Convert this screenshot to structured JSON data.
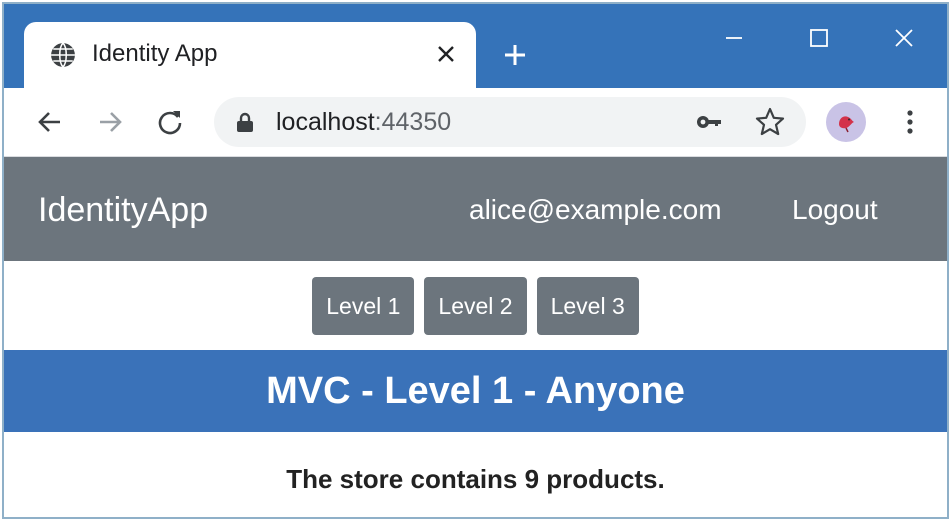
{
  "browser": {
    "tab": {
      "title": "Identity App",
      "favicon": "globe-icon",
      "close_icon": "close-icon"
    },
    "new_tab_icon": "plus-icon",
    "window_controls": [
      "minimize-icon",
      "maximize-icon",
      "close-icon"
    ],
    "toolbar": {
      "back_icon": "arrow-left-icon",
      "forward_icon": "arrow-right-icon",
      "reload_icon": "reload-icon",
      "url_host": "localhost",
      "url_port": ":44350",
      "lock_icon": "lock-icon",
      "key_icon": "key-icon",
      "star_icon": "star-icon",
      "menu_icon": "vertical-dots-icon"
    },
    "colors": {
      "titlebar": "#3573b9",
      "omnibox": "#f1f3f4"
    }
  },
  "page": {
    "navbar": {
      "brand": "IdentityApp",
      "user_email": "alice@example.com",
      "logout_label": "Logout"
    },
    "levels": [
      "Level 1",
      "Level 2",
      "Level 3"
    ],
    "banner": "MVC - Level 1 - Anyone",
    "message": "The store contains 9 products.",
    "colors": {
      "navbar": "#6c757d",
      "banner": "#3a72b9",
      "button": "#6c757d"
    }
  }
}
